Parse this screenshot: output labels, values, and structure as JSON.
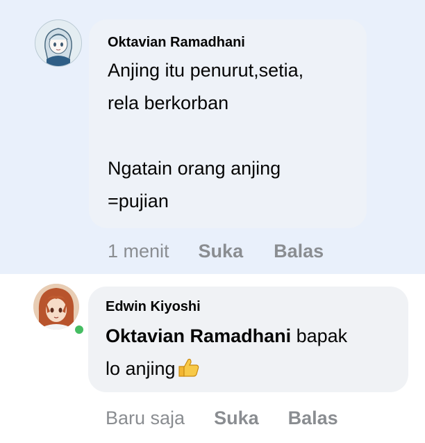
{
  "comments": [
    {
      "author": "Oktavian Ramadhani",
      "lines": [
        "Anjing itu penurut,setia,",
        "rela berkorban",
        "",
        "Ngatain orang anjing",
        "=pujian"
      ],
      "time": "1 menit",
      "like_label": "Suka",
      "reply_label": "Balas"
    },
    {
      "author": "Edwin Kiyoshi",
      "mention": "Oktavian Ramadhani",
      "text_after_mention": " bapak",
      "line2": "lo anjing",
      "time": "Baru saja",
      "like_label": "Suka",
      "reply_label": "Balas",
      "emoji": "thumbs-up-icon"
    }
  ],
  "colors": {
    "highlight_bg": "#e9f0fb",
    "bubble_bg": "#f0f2f5",
    "meta_text": "#8a8d91",
    "online": "#45bd62"
  }
}
